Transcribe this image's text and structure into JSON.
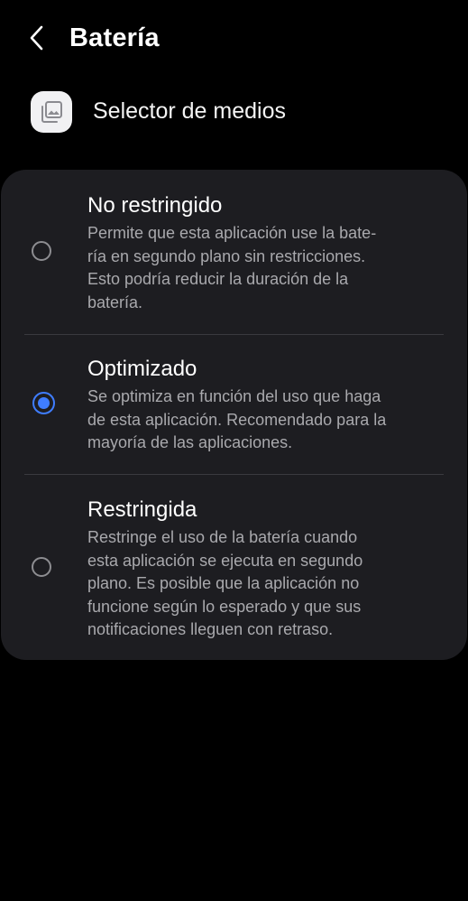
{
  "header": {
    "title": "Batería",
    "back_icon": "chevron-left-icon"
  },
  "app": {
    "name": "Selector de medios",
    "icon": "media-picker-icon"
  },
  "options": [
    {
      "title": "No restringido",
      "description": "Permite que esta aplicación use la bate-\nría en segundo plano sin restricciones.\nEsto podría reducir la duración de la\nbatería.",
      "selected": false
    },
    {
      "title": "Optimizado",
      "description": "Se optimiza en función del uso que haga\nde esta aplicación. Recomendado para la\nmayoría de las aplicaciones.",
      "selected": true
    },
    {
      "title": "Restringida",
      "description": "Restringe el uso de la batería cuando\nesta aplicación se ejecuta en segundo\nplano. Es posible que la aplicación no\nfuncione según lo esperado y que sus\nnotificaciones lleguen con retraso.",
      "selected": false
    }
  ],
  "colors": {
    "background": "#000000",
    "card": "#1d1d21",
    "accent": "#3f7dff",
    "secondary_text": "#a9a9ad"
  }
}
